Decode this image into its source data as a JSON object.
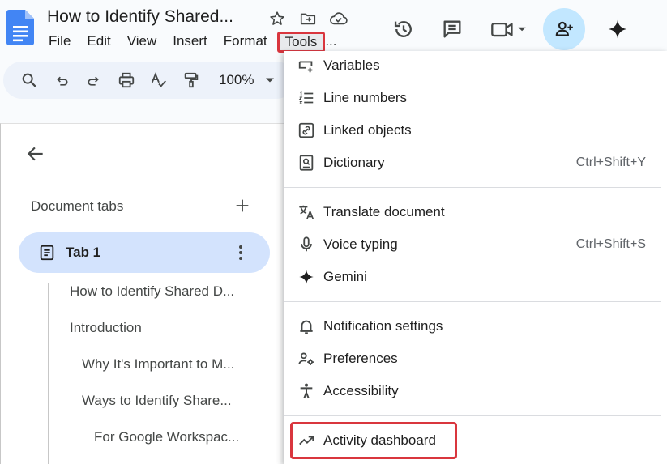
{
  "document": {
    "title": "How to Identify Shared..."
  },
  "menubar": {
    "items": [
      "File",
      "Edit",
      "View",
      "Insert",
      "Format",
      "Tools"
    ],
    "overflow": "..."
  },
  "toolbar": {
    "zoom": "100%"
  },
  "left_panel": {
    "heading": "Document tabs",
    "tab_label": "Tab 1",
    "outline": [
      "How to Identify Shared D...",
      "Introduction",
      "Why It's Important to M...",
      "Ways to Identify Share...",
      "For Google Workspac..."
    ]
  },
  "tools_menu": {
    "items": [
      {
        "label": "Variables",
        "shortcut": "",
        "icon": "variables-icon"
      },
      {
        "label": "Line numbers",
        "shortcut": "",
        "icon": "line-numbers-icon"
      },
      {
        "label": "Linked objects",
        "shortcut": "",
        "icon": "linked-objects-icon"
      },
      {
        "label": "Dictionary",
        "shortcut": "Ctrl+Shift+Y",
        "icon": "dictionary-icon"
      },
      {
        "label": "Translate document",
        "shortcut": "",
        "icon": "translate-icon"
      },
      {
        "label": "Voice typing",
        "shortcut": "Ctrl+Shift+S",
        "icon": "microphone-icon"
      },
      {
        "label": "Gemini",
        "shortcut": "",
        "icon": "gemini-sparkle-icon"
      },
      {
        "label": "Notification settings",
        "shortcut": "",
        "icon": "bell-icon"
      },
      {
        "label": "Preferences",
        "shortcut": "",
        "icon": "preferences-icon"
      },
      {
        "label": "Accessibility",
        "shortcut": "",
        "icon": "accessibility-icon"
      },
      {
        "label": "Activity dashboard",
        "shortcut": "",
        "icon": "trending-up-icon"
      }
    ]
  },
  "colors": {
    "accent_blue": "#c2e7ff",
    "selected_tab": "#d3e3fd",
    "highlight_red": "#d9363e",
    "docs_blue": "#4285f4"
  }
}
